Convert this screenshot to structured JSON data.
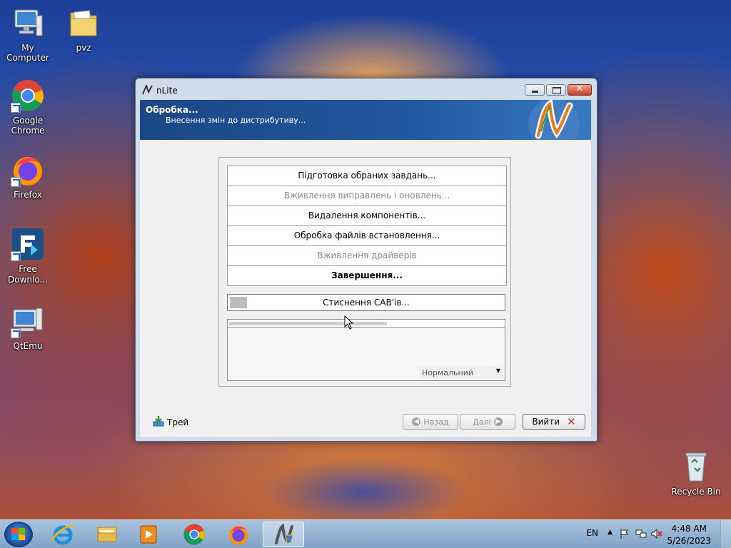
{
  "desktop": {
    "icons": [
      {
        "label": "My Computer",
        "icon": "computer-icon"
      },
      {
        "label": "pvz",
        "icon": "folder-icon"
      },
      {
        "label": "Google Chrome",
        "icon": "chrome-icon"
      },
      {
        "label": "Firefox",
        "icon": "firefox-icon"
      },
      {
        "label": "Free Downlo...",
        "icon": "free-download-manager-icon"
      },
      {
        "label": "QtEmu",
        "icon": "qtemu-icon"
      },
      {
        "label": "Recycle Bin",
        "icon": "recycle-bin-icon"
      }
    ]
  },
  "window": {
    "title": "nLite",
    "banner": {
      "title": "Обробка...",
      "subtitle": "Внесення змін до дистрибутиву..."
    },
    "tasks": [
      {
        "label": "Підготовка обраних завдань...",
        "state": "normal"
      },
      {
        "label": "Вживлення виправлень і оновлень...",
        "state": "disabled"
      },
      {
        "label": "Видалення компонентів...",
        "state": "normal"
      },
      {
        "label": "Обробка файлів встановлення...",
        "state": "normal"
      },
      {
        "label": "Вживлення драйверів",
        "state": "disabled"
      },
      {
        "label": "Завершення...",
        "state": "current"
      }
    ],
    "current_operation": "Стиснення CAB'ів...",
    "progress_fraction": 0.57,
    "priority": {
      "selected": "Нормальний"
    },
    "footer": {
      "tray_label": "Трей",
      "back_label": "Назад",
      "next_label": "Далі",
      "exit_label": "Вийти"
    }
  },
  "taskbar": {
    "apps": [
      "windows-explorer-icon",
      "internet-explorer-icon",
      "file-explorer-icon",
      "media-player-icon",
      "chrome-icon",
      "firefox-icon",
      "nlite-icon"
    ],
    "language": "EN",
    "time": "4:48 AM",
    "date": "5/26/2023"
  }
}
